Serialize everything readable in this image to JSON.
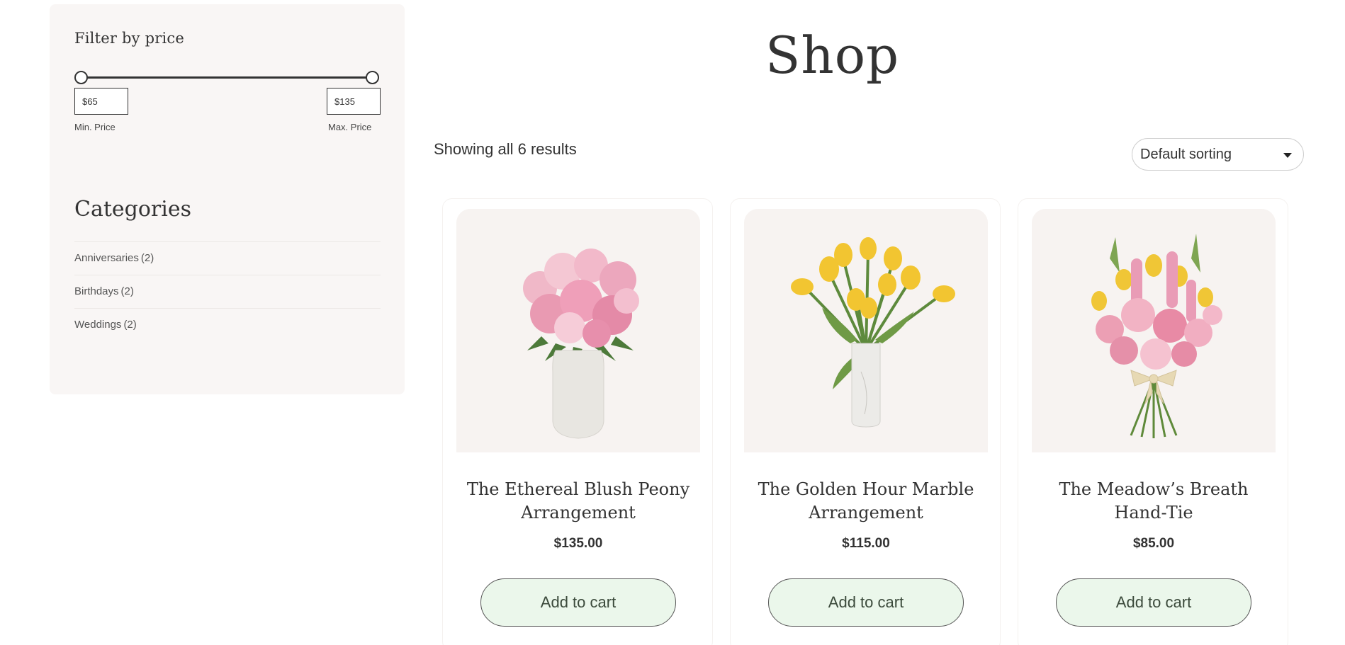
{
  "sidebar": {
    "filter": {
      "title": "Filter by price",
      "min_value": "$65",
      "max_value": "$135",
      "min_label": "Min. Price",
      "max_label": "Max. Price"
    },
    "categories": {
      "title": "Categories",
      "items": [
        {
          "name": "Anniversaries",
          "count": "(2)"
        },
        {
          "name": "Birthdays",
          "count": "(2)"
        },
        {
          "name": "Weddings",
          "count": "(2)"
        }
      ]
    }
  },
  "main": {
    "title": "Shop",
    "result_count": "Showing all 6 results",
    "sorting": "Default sorting",
    "products": [
      {
        "title": "The Ethereal Blush Peony Arrangement",
        "price": "$135.00",
        "button": "Add to cart",
        "image": "pink-peony-bouquet-in-white-vase"
      },
      {
        "title": "The Golden Hour Marble Arrangement",
        "price": "$115.00",
        "button": "Add to cart",
        "image": "yellow-tulips-in-marble-vase"
      },
      {
        "title": "The Meadow’s Breath Hand-Tie",
        "price": "$85.00",
        "button": "Add to cart",
        "image": "pink-and-yellow-hand-tied-bouquet"
      }
    ]
  },
  "colors": {
    "sidebar_bg": "#f9f6f5",
    "button_bg": "#ebf7eb",
    "text": "#333333"
  }
}
